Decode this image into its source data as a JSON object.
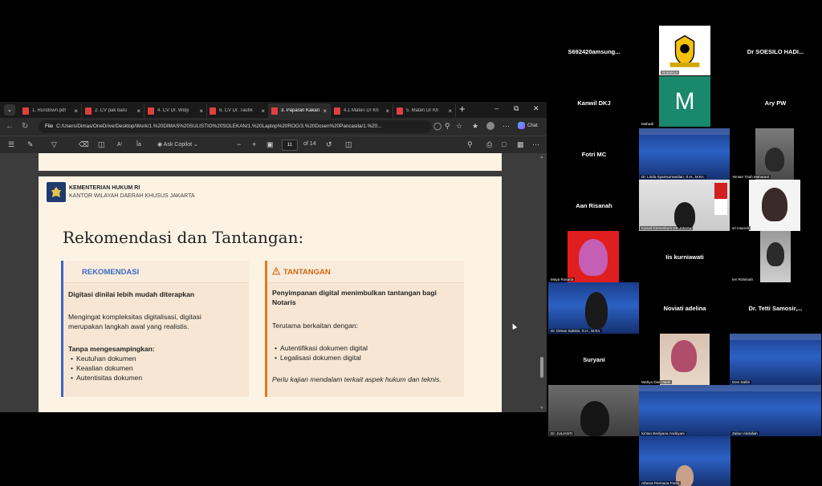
{
  "browser": {
    "tabs": [
      {
        "label": "1. Rundown.pdf",
        "active": false
      },
      {
        "label": "2. CV pak baru",
        "active": false
      },
      {
        "label": "4. CV Dr. Widji",
        "active": false
      },
      {
        "label": "6. CV Dr. Taufik",
        "active": false
      },
      {
        "label": "3. Paparan Kakan",
        "active": true
      },
      {
        "label": "4.1 Materi Dr Kh",
        "active": false
      },
      {
        "label": "5. Materi Dr Kh",
        "active": false
      }
    ],
    "url_scheme_label": "File",
    "url": "C:/Users/Dimas/OneDrive/Desktop/Work/1.%20DIMAS%20SULISTIO%20SOLEKAN/1.%20Laptop%20ROG/3.%20Dosen%20Pancasila/1.%20...",
    "chat_label": "Chat"
  },
  "pdf_toolbar": {
    "ask_copilot": "Ask Copilot",
    "current_page": "11",
    "page_total": "of 14",
    "zoom_out": "−",
    "zoom_in": "+"
  },
  "slide": {
    "org_name": "KEMENTERIAN HUKUM RI",
    "org_sub": "KANTOR WILAYAH DAERAH KHUSUS JAKARTA",
    "title": "Rekomendasi dan Tantangan:",
    "left_card": {
      "header": "REKOMENDASI",
      "heading": "Digitasi dinilai lebih mudah diterapkan",
      "para_line1": "Mengingat kompleksitas digitalisasi, digitasi",
      "para_line2": "merupakan langkah awal yang realistis.",
      "sub_heading": "Tanpa mengesampingkan:",
      "bullets": [
        "Keutuhan dokumen",
        "Keaslian dokumen",
        "Autentisitas dokumen"
      ]
    },
    "right_card": {
      "header": "TANTANGAN",
      "heading_line1": "Penyimpanan digital menimbulkan tantangan bagi",
      "heading_line2": "Notaris",
      "intro": "Terutama berkaitan dengan:",
      "bullets": [
        "Autentifikasi dokumen digital",
        "Legalisasi dokumen digital"
      ],
      "note": "Perlu kajian mendalam terkait aspek hukum dan teknis."
    }
  },
  "participants": {
    "p01": {
      "name": "S692420amsung..."
    },
    "p02": {
      "label": "NotarisUI"
    },
    "p03": {
      "name": "Dr SOESILO HADI..."
    },
    "p04": {
      "name": "Kanwil DKJ"
    },
    "p05": {
      "label": "Mahadi",
      "avatar_letter": "M"
    },
    "p06": {
      "name": "Ary PW"
    },
    "p07": {
      "name": "Fotri MC"
    },
    "p08": {
      "label": "Dr. Linda Syamsumardian, S.H., M.Kn."
    },
    "p09": {
      "label": "Yenser Triah Maharani"
    },
    "p10": {
      "name": "Aan Risanah"
    },
    "p11": {
      "label": "Kanwil Kemenkum DK Jakarta"
    },
    "p12": {
      "label": "sri intanoh"
    },
    "p13": {
      "label": "Maya Rosaria"
    },
    "p14": {
      "name": "Iis kurniawati"
    },
    "p15": {
      "label": "Ien Rohimah"
    },
    "p16": {
      "label": "Dr. Dimas Sulistio, S.H., M.Kn."
    },
    "p17": {
      "name": "Noviati adelina"
    },
    "p18": {
      "name": "Dr. Tetti Samosir,..."
    },
    "p19": {
      "name": "Suryani"
    },
    "p20": {
      "label": "Wahyu Dwi Utami"
    },
    "p21": {
      "label": "Devi Safitri"
    },
    "p22": {
      "label": "Dr. JULIANTI"
    },
    "p23": {
      "label": "Kintan Berliyana Andriyani"
    },
    "p24": {
      "label": "Zaitun Abdullah"
    },
    "p25": {
      "label": "Athena Permana Putra"
    }
  },
  "colors": {
    "slide_bg": "#fdf3e4",
    "recommendation_accent": "#3b68c4",
    "challenge_accent": "#e07b1a",
    "avatar_green": "#19886c"
  }
}
